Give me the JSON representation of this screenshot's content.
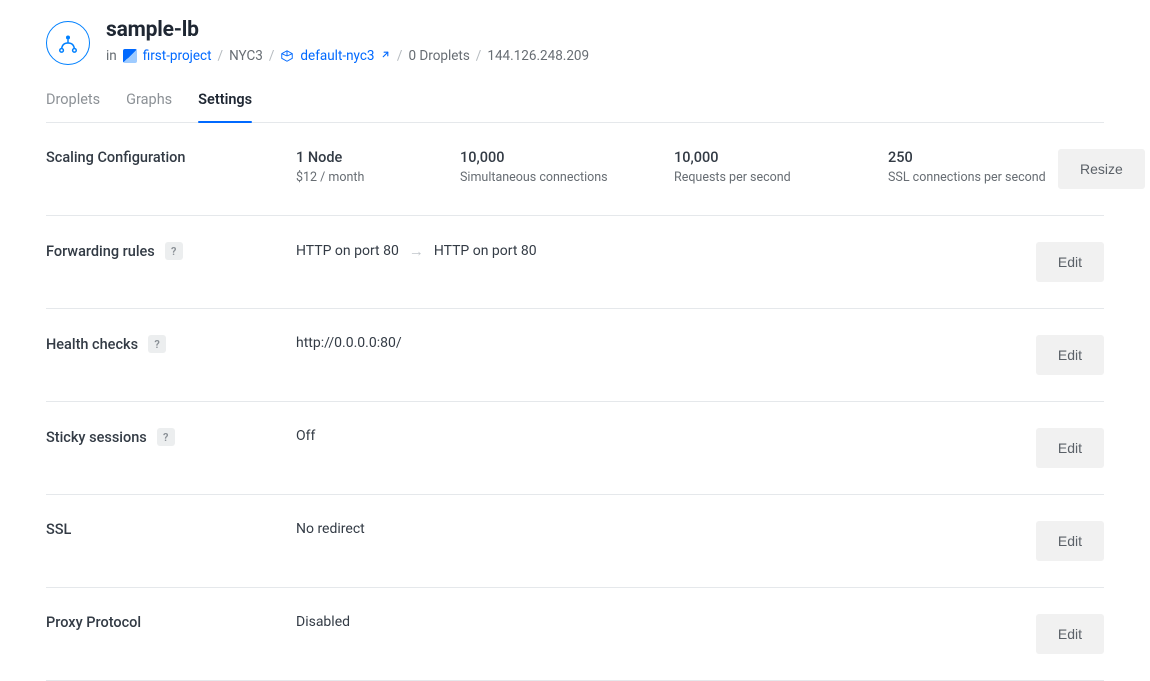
{
  "header": {
    "title": "sample-lb",
    "in_label": "in",
    "project": "first-project",
    "region": "NYC3",
    "vpc": "default-nyc3",
    "droplet_count": "0 Droplets",
    "ip": "144.126.248.209"
  },
  "tabs": [
    {
      "id": "droplets",
      "label": "Droplets",
      "active": false
    },
    {
      "id": "graphs",
      "label": "Graphs",
      "active": false
    },
    {
      "id": "settings",
      "label": "Settings",
      "active": true
    }
  ],
  "scaling": {
    "label": "Scaling Configuration",
    "metrics": {
      "nodes": {
        "value": "1 Node",
        "sub": "$12 / month"
      },
      "sim_conn": {
        "value": "10,000",
        "sub": "Simultaneous connections"
      },
      "rps": {
        "value": "10,000",
        "sub": "Requests per second"
      },
      "ssl_cps": {
        "value": "250",
        "sub": "SSL connections per second"
      }
    },
    "button": "Resize"
  },
  "settings_rows": {
    "forwarding": {
      "label": "Forwarding rules",
      "help": "?",
      "from": "HTTP on port 80",
      "to": "HTTP on port 80",
      "button": "Edit"
    },
    "health": {
      "label": "Health checks",
      "help": "?",
      "value": "http://0.0.0.0:80/",
      "button": "Edit"
    },
    "sticky": {
      "label": "Sticky sessions",
      "help": "?",
      "value": "Off",
      "button": "Edit"
    },
    "ssl": {
      "label": "SSL",
      "value": "No redirect",
      "button": "Edit"
    },
    "proxy": {
      "label": "Proxy Protocol",
      "value": "Disabled",
      "button": "Edit"
    }
  }
}
